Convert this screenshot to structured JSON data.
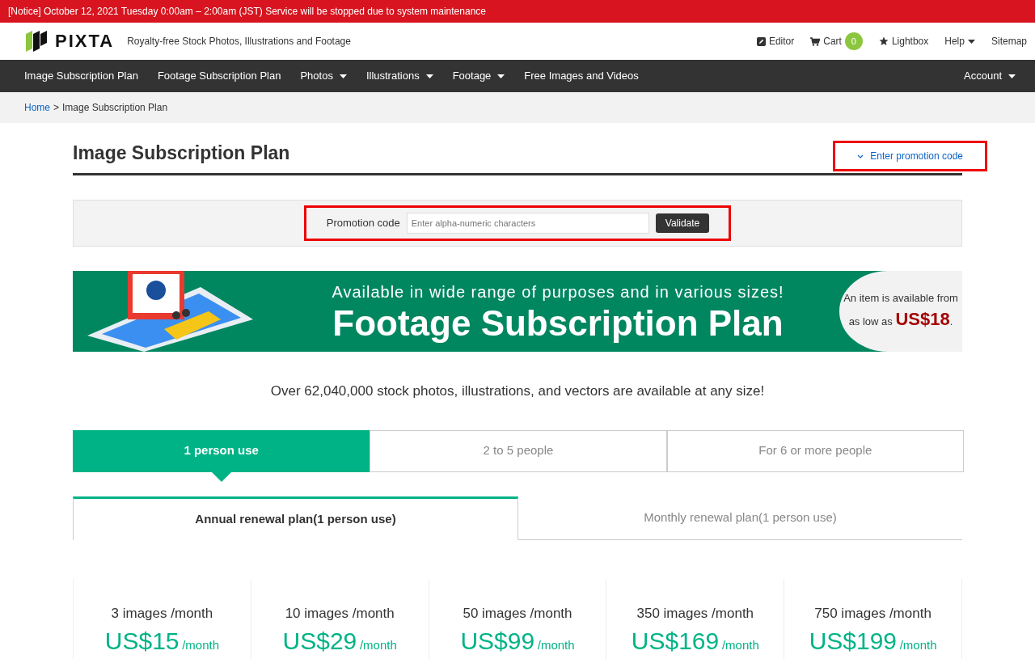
{
  "notice": "[Notice] October 12, 2021 Tuesday 0:00am – 2:00am (JST) Service will be stopped due to system maintenance",
  "header": {
    "logo": "PIXTA",
    "tagline": "Royalty-free Stock Photos, Illustrations and Footage",
    "links": [
      {
        "kind": "editor",
        "label": "Editor"
      },
      {
        "kind": "cart",
        "label": "Cart",
        "badge": "0"
      },
      {
        "kind": "lightbox",
        "label": "Lightbox"
      },
      {
        "kind": "dropdown",
        "label": "Help"
      },
      {
        "kind": "plain",
        "label": "Sitemap"
      }
    ]
  },
  "nav": {
    "items": [
      {
        "label": "Image Subscription Plan",
        "dropdown": false
      },
      {
        "label": "Footage Subscription Plan",
        "dropdown": false
      },
      {
        "label": "Photos",
        "dropdown": true
      },
      {
        "label": "Illustrations",
        "dropdown": true
      },
      {
        "label": "Footage",
        "dropdown": true
      },
      {
        "label": "Free Images and Videos",
        "dropdown": false
      }
    ],
    "account": "Account"
  },
  "breadcrumb": {
    "link": "Home",
    "separator": ">",
    "current": "Image Subscription Plan"
  },
  "page_title": "Image Subscription Plan",
  "promo_toggle": "Enter promotion code",
  "promo_form": {
    "label": "Promotion code",
    "placeholder": "Enter alpha-numeric characters",
    "button": "Validate"
  },
  "banner": {
    "subtitle": "Available in wide range of purposes and in various sizes!",
    "title": "Footage Subscription Plan",
    "side_line1": "An item is available from",
    "side_line2": "as low as",
    "price": "US$18",
    "period": "."
  },
  "summary": "Over 62,040,000 stock photos, illustrations, and vectors are available at any size!",
  "people_tabs": [
    {
      "label": "1 person use",
      "selected": true
    },
    {
      "label": "2 to 5 people",
      "selected": false
    },
    {
      "label": "For 6 or more people",
      "selected": false
    }
  ],
  "plan_tabs": [
    {
      "label": "Annual renewal plan(1 person use)",
      "selected": true
    },
    {
      "label": "Monthly renewal plan(1 person use)",
      "selected": false
    }
  ],
  "plans": [
    {
      "images": "3 images /month",
      "price": "US$15",
      "unit": "/month"
    },
    {
      "images": "10 images /month",
      "price": "US$29",
      "unit": "/month"
    },
    {
      "images": "50 images /month",
      "price": "US$99",
      "unit": "/month"
    },
    {
      "images": "350 images /month",
      "price": "US$169",
      "unit": "/month"
    },
    {
      "images": "750 images /month",
      "price": "US$199",
      "unit": "/month"
    }
  ]
}
